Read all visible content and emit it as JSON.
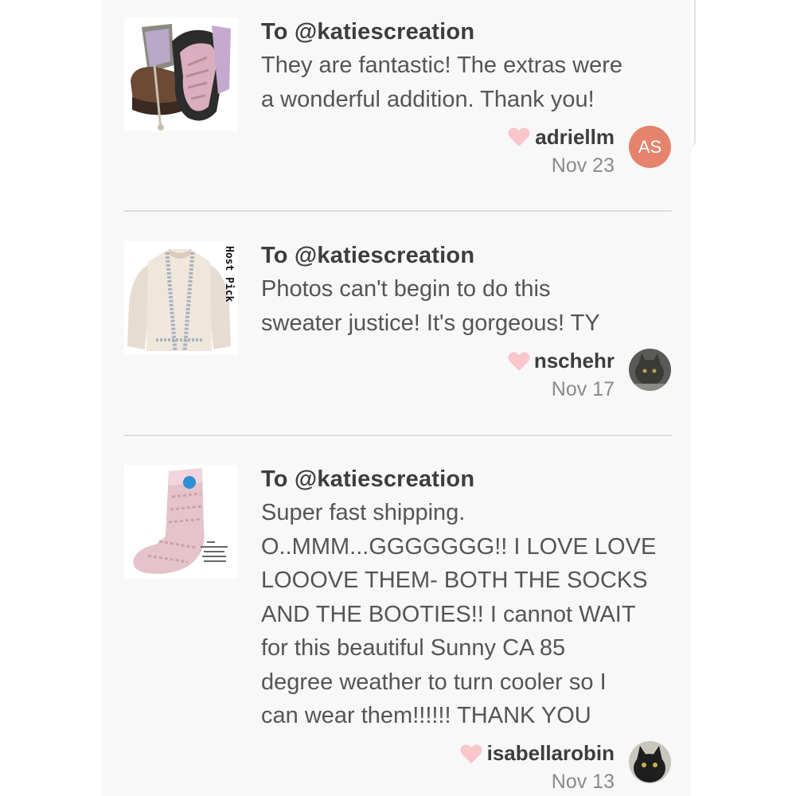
{
  "reviews": [
    {
      "to": "To @katiescreation",
      "comment_lines": [
        "They are fantastic! The extras were",
        "a wonderful addition. Thank you!"
      ],
      "username": "adriellm",
      "date": "Nov 23",
      "avatar_initials": "AS",
      "thumbnail": "boots-image"
    },
    {
      "to": "To @katiescreation",
      "comment_lines": [
        "Photos can't begin to do this",
        "sweater justice! It's gorgeous! TY"
      ],
      "username": "nschehr",
      "date": "Nov 17",
      "thumbnail": "sweater-image",
      "thumbnail_badge": "Host Pick"
    },
    {
      "to": "To @katiescreation",
      "comment_lines": [
        "Super fast shipping.",
        "O..MMM...GGGGGGG!! I LOVE LOVE",
        "LOOOVE THEM- BOTH THE SOCKS",
        "AND THE BOOTIES!! I cannot WAIT",
        "for this beautiful Sunny CA 85",
        "degree weather to turn cooler so I",
        "can wear them!!!!!! THANK YOU"
      ],
      "username": "isabellarobin",
      "date": "Nov 13",
      "thumbnail": "socks-image"
    }
  ],
  "colors": {
    "heart": "#f9c6cc",
    "avatar_as": "#e5836d",
    "text_primary": "#3d3d3d",
    "text_secondary": "#555555"
  }
}
